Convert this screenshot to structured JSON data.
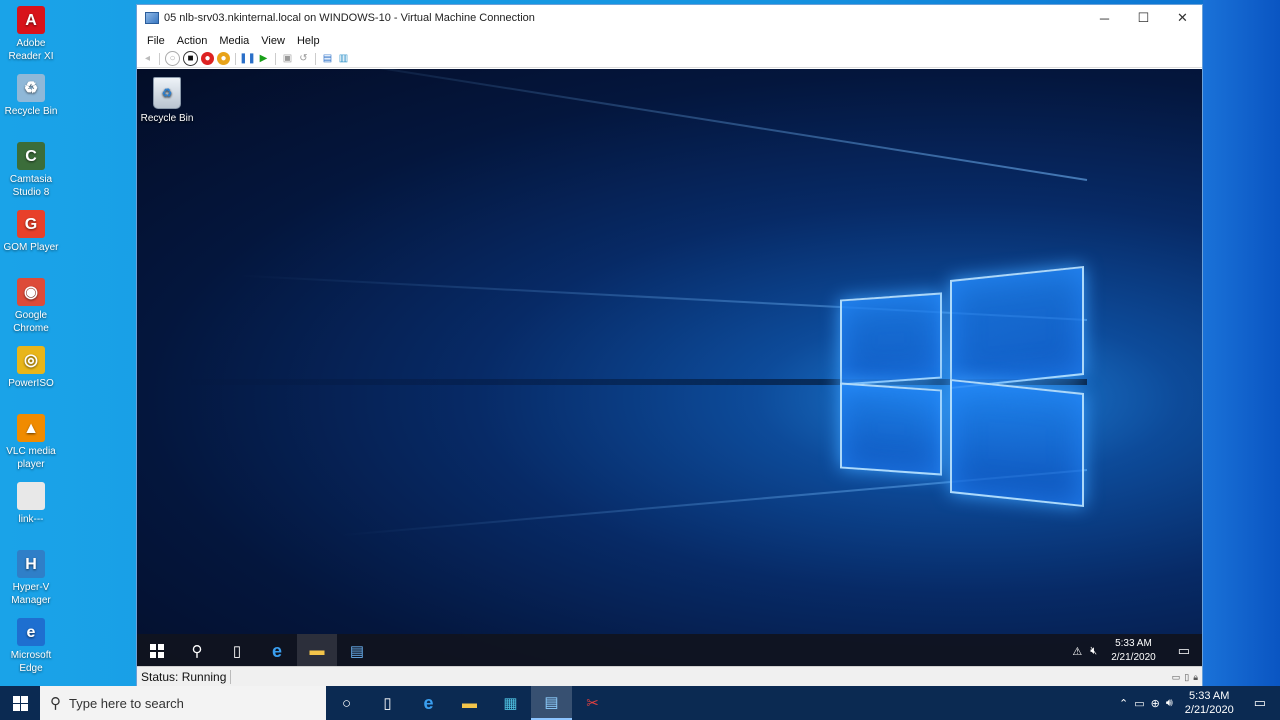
{
  "host_desktop": {
    "icons": [
      {
        "label": "Adobe\nReader XI",
        "name": "adobe-reader-icon",
        "glyph": "A",
        "color": "#d8131b"
      },
      {
        "label": "Recycle Bin",
        "name": "recycle-bin-icon",
        "glyph": "♻",
        "color": "#8fb8d8"
      },
      {
        "label": "Camtasia\nStudio 8",
        "name": "camtasia-icon",
        "glyph": "C",
        "color": "#3b6d3a"
      },
      {
        "label": "GOM Player",
        "name": "gom-player-icon",
        "glyph": "G",
        "color": "#e8402a"
      },
      {
        "label": "Google\nChrome",
        "name": "chrome-icon",
        "glyph": "◉",
        "color": "#dd4b39"
      },
      {
        "label": "PowerISO",
        "name": "poweriso-icon",
        "glyph": "◎",
        "color": "#e8b51a"
      },
      {
        "label": "VLC media\nplayer",
        "name": "vlc-icon",
        "glyph": "▲",
        "color": "#f08b00"
      },
      {
        "label": "link---",
        "name": "file-icon",
        "glyph": "",
        "color": "#e8e8e8"
      },
      {
        "label": "Hyper-V\nManager",
        "name": "hyperv-manager-icon",
        "glyph": "H",
        "color": "#2f7fc8"
      },
      {
        "label": "Microsoft\nEdge",
        "name": "edge-icon",
        "glyph": "e",
        "color": "#1e6fd0"
      }
    ]
  },
  "vm_window": {
    "title": "05 nlb-srv03.nkinternal.local on WINDOWS-10 - Virtual Machine Connection",
    "minimize": "─",
    "maximize": "☐",
    "close": "✕",
    "menu": {
      "file": "File",
      "action": "Action",
      "media": "Media",
      "view": "View",
      "help": "Help"
    },
    "status": "Status: Running"
  },
  "guest": {
    "recycle_bin_label": "Recycle Bin",
    "clock_time": "5:33 AM",
    "clock_date": "2/21/2020"
  },
  "host_taskbar": {
    "search_placeholder": "Type here to search",
    "clock_time": "5:33 AM",
    "clock_date": "2/21/2020"
  },
  "colors": {
    "accent": "#0078d7",
    "host_taskbar": "#0b2a52",
    "guest_taskbar": "#10141e"
  }
}
